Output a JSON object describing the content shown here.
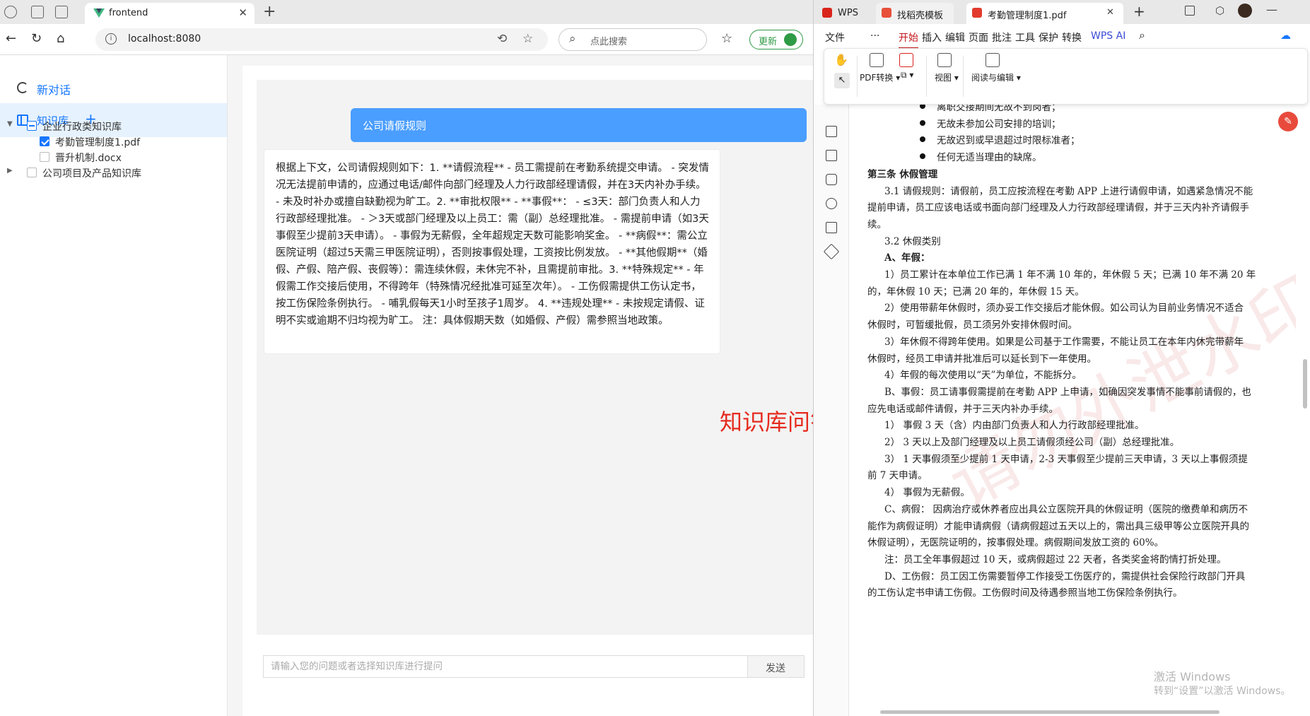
{
  "browser": {
    "tab_title": "frontend",
    "url": "localhost:8080",
    "search_placeholder": "点此搜索",
    "update_label": "更新"
  },
  "sidebar": {
    "new_chat": "新对话",
    "knowledge_base": "知识库",
    "add": "+",
    "tree": [
      {
        "label": "企业行政类知识库",
        "state": "partial",
        "expanded": true
      },
      {
        "label": "考勤管理制度1.pdf",
        "state": "checked"
      },
      {
        "label": "晋升机制.docx",
        "state": "unchecked"
      },
      {
        "label": "公司项目及产品知识库",
        "state": "unchecked",
        "expanded": false
      }
    ]
  },
  "chat": {
    "question": "公司请假规则",
    "answer": "根据上下文，公司请假规则如下：1. **请假流程** - 员工需提前在考勤系统提交申请。 - 突发情况无法提前申请的，应通过电话/邮件向部门经理及人力行政部经理请假，并在3天内补办手续。 - 未及时补办或擅自缺勤视为旷工。2. **审批权限** - **事假**： - ≤3天：部门负责人和人力行政部经理批准。 - ＞3天或部门经理及以上员工：需（副）总经理批准。 - 需提前申请（如3天事假至少提前3天申请）。 - 事假为无薪假，全年超规定天数可能影响奖金。 - **病假**：需公立医院证明（超过5天需三甲医院证明），否则按事假处理，工资按比例发放。 - **其他假期**（婚假、产假、陪产假、丧假等）：需连续休假，未休完不补，且需提前审批。3. **特殊规定** - 年假需工作交接后使用，不得跨年（特殊情况经批准可延至次年）。 - 工伤假需提供工伤认定书，按工伤保险条例执行。 - 哺乳假每天1小时至孩子1周岁。 4. **违规处理** - 未按规定请假、证明不实或逾期不归均视为旷工。 注：具体假期天数（如婚假、产假）需参照当地政策。",
    "input_placeholder": "请输入您的问题或者选择知识库进行提问",
    "send_label": "发送",
    "overlay_label": "知识库问答"
  },
  "wps": {
    "tabs": [
      "WPS",
      "找稻壳模板",
      "考勤管理制度1.pdf"
    ],
    "menu": [
      "文件",
      "···",
      "开始",
      "插入",
      "编辑",
      "页面",
      "批注",
      "工具",
      "保护",
      "转换",
      "WPS AI"
    ],
    "ribbon": [
      "PDF转换",
      "视图",
      "阅读与编辑"
    ],
    "doc_lines": [
      {
        "text": "离职交接期间无故不到岗者；",
        "bullet": true
      },
      {
        "text": "无故未参加公司安排的培训；",
        "bullet": true
      },
      {
        "text": "无故迟到或早退超过时限标准者；",
        "bullet": true
      },
      {
        "text": "任何无适当理由的缺席。",
        "bullet": true
      },
      {
        "text": "第三条  休假管理",
        "bold": true
      },
      {
        "text": "3.1 请假规则：请假前，员工应按流程在考勤 APP 上进行请假申请，如遇紧急情况不能",
        "indent": true
      },
      {
        "text": "提前申请，员工应该电话或书面向部门经理及人力行政部经理请假，并于三天内补齐请假手"
      },
      {
        "text": "续。"
      },
      {
        "text": "3.2 休假类别",
        "indent": true
      },
      {
        "text": "A、年假：",
        "indent": true,
        "bold": true
      },
      {
        "text": "1）员工累计在本单位工作已满 1 年不满 10 年的，年休假 5 天；已满 10 年不满 20 年",
        "indent": true
      },
      {
        "text": "的，年休假 10 天；已满 20 年的，年休假 15 天。"
      },
      {
        "text": "2）使用带薪年休假时，须办妥工作交接后才能休假。如公司认为目前业务情况不适合",
        "indent": true
      },
      {
        "text": "休假时，可暂缓批假，员工须另外安排休假时间。"
      },
      {
        "text": "3）年休假不得跨年使用。如果是公司基于工作需要，不能让员工在本年内休完带薪年",
        "indent": true
      },
      {
        "text": "休假时，经员工申请并批准后可以延长到下一年使用。"
      },
      {
        "text": "4）年假的每次使用以“天”为单位，不能拆分。",
        "indent": true
      },
      {
        "text": "B、事假：员工请事假需提前在考勤 APP 上申请，如确因突发事情不能事前请假的，也",
        "indent": true
      },
      {
        "text": "应先电话或邮件请假，并于三天内补办手续。"
      },
      {
        "text": "1）  事假 3 天（含）内由部门负责人和人力行政部经理批准。",
        "indent": true
      },
      {
        "text": "2）  3 天以上及部门经理及以上员工请假须经公司（副）总经理批准。",
        "indent": true
      },
      {
        "text": "3）  1 天事假须至少提前 1 天申请，2-3 天事假至少提前三天申请，3 天以上事假须提",
        "indent": true
      },
      {
        "text": "前 7 天申请。"
      },
      {
        "text": "4）  事假为无薪假。",
        "indent": true
      },
      {
        "text": "C、病假：  因病治疗或休养者应出具公立医院开具的休假证明（医院的缴费单和病历不",
        "indent": true
      },
      {
        "text": "能作为病假证明）才能申请病假（请病假超过五天以上的，需出具三级甲等公立医院开具的"
      },
      {
        "text": "休假证明），无医院证明的，按事假处理。病假期间发放工资的 60%。"
      },
      {
        "text": "注：员工全年事假超过 10 天，或病假超过 22 天者，各类奖金将酌情打折处理。",
        "indent": true
      },
      {
        "text": "D、工伤假：员工因工伤需要暂停工作接受工伤医疗的，需提供社会保险行政部门开具",
        "indent": true
      },
      {
        "text": "的工伤认定书申请工伤假。工伤假时间及待遇参照当地工伤保险条例执行。"
      }
    ],
    "watermark": "请勿外泄水印",
    "activation": [
      "激活 Windows",
      "转到“设置”以激活 Windows。"
    ]
  }
}
